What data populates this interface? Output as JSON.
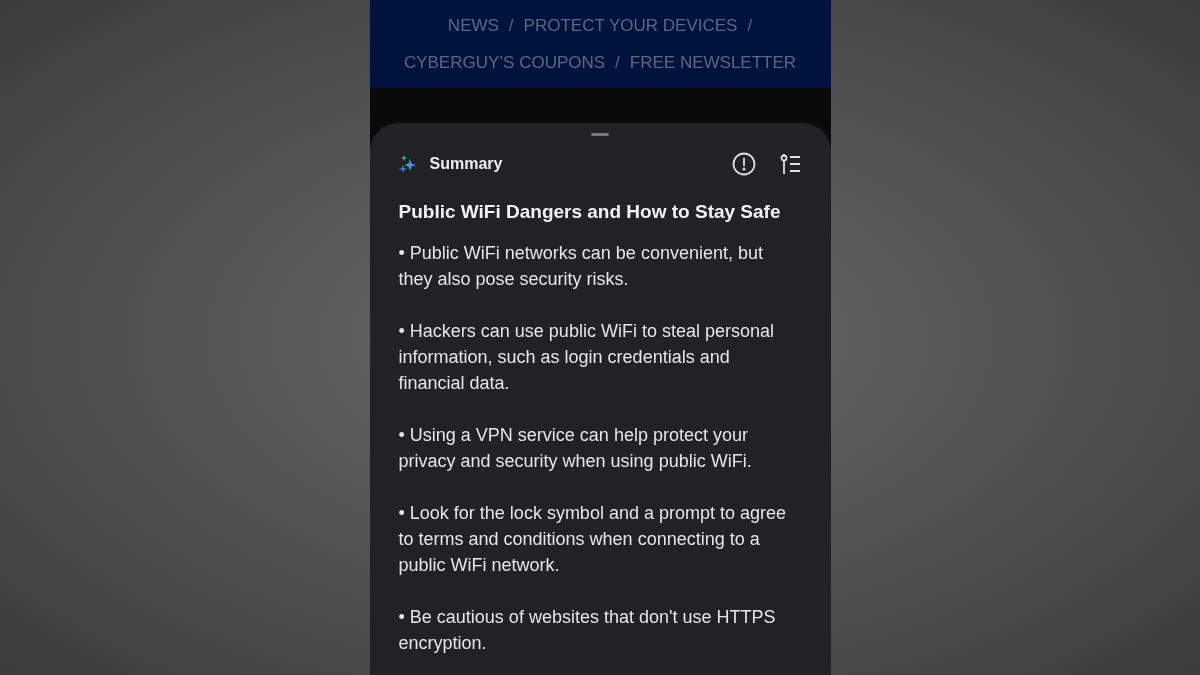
{
  "nav": {
    "separator": "/",
    "rows": [
      [
        "NEWS",
        "PROTECT YOUR DEVICES"
      ],
      [
        "CYBERGUY’S COUPONS",
        "FREE NEWSLETTER"
      ]
    ]
  },
  "summary_panel": {
    "header": "Summary",
    "title": "Public WiFi Dangers and How to Stay Safe",
    "bullets": [
      "• Public WiFi networks can be convenient, but they also pose security risks.",
      "• Hackers can use public WiFi to steal personal information, such as login credentials and financial data.",
      "• Using a VPN service can help protect your privacy and security when using public WiFi.",
      "• Look for the lock symbol and a prompt to agree to terms and conditions when connecting to a public WiFi network.",
      "• Be cautious of websites that don't use HTTPS encryption."
    ]
  }
}
